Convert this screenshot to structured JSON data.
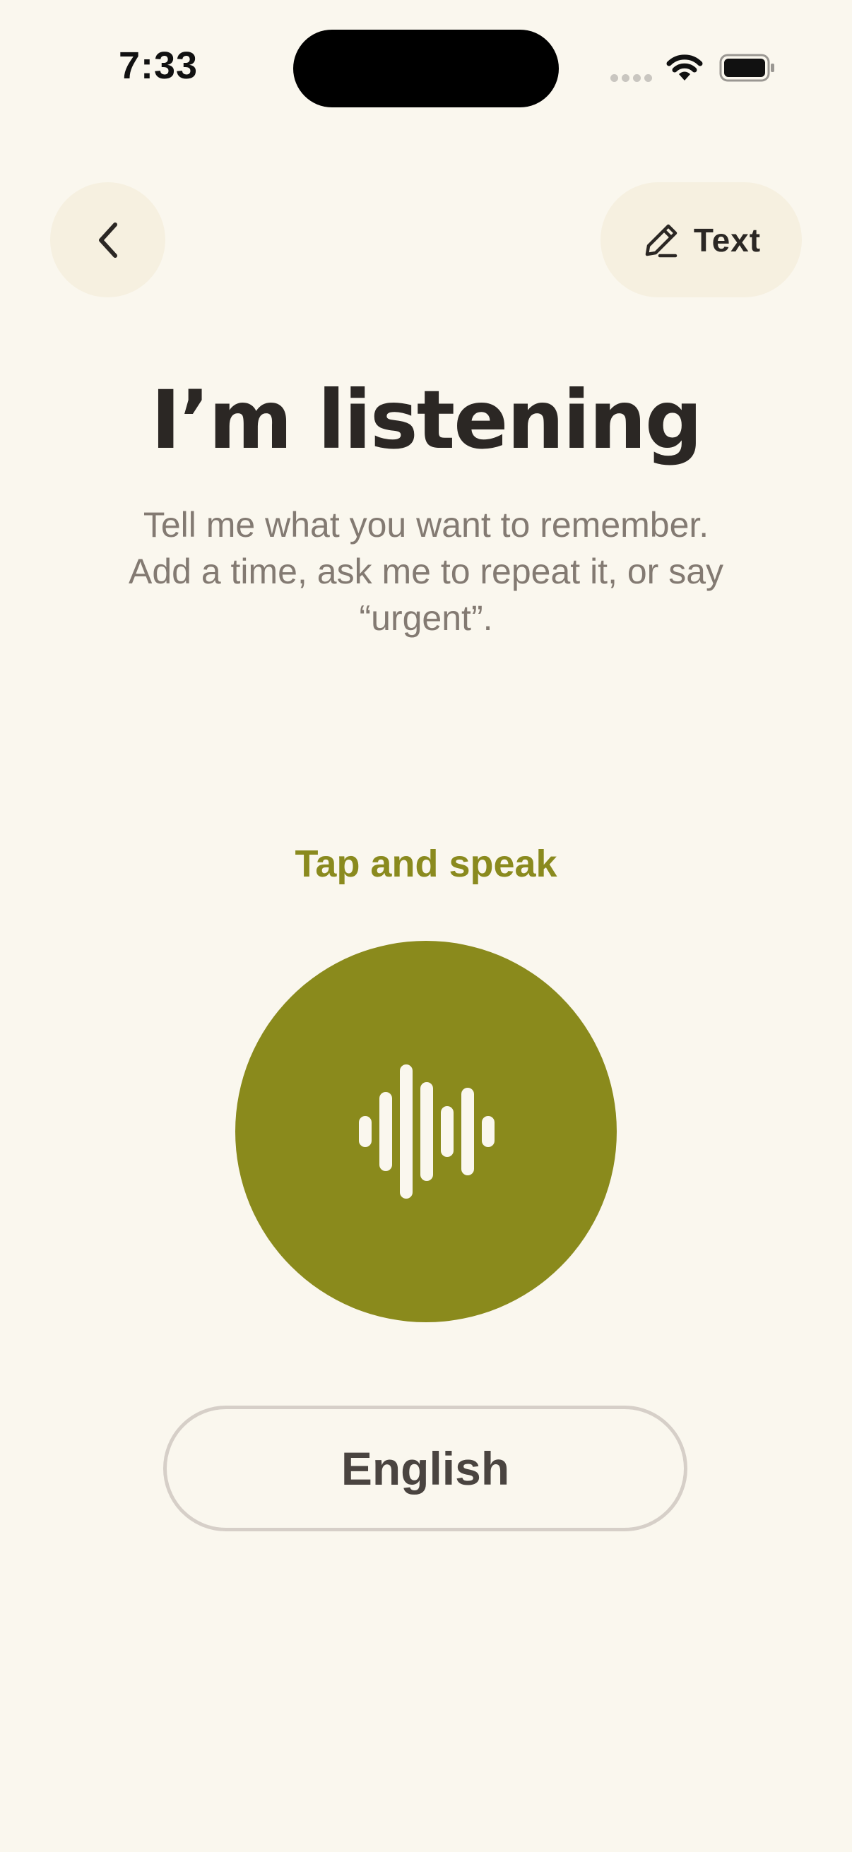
{
  "status_bar": {
    "time": "7:33"
  },
  "header": {
    "back_icon": "chevron-left-icon",
    "text_mode_icon": "pencil-icon",
    "text_mode_label": "Text"
  },
  "main": {
    "title": "I’m listening",
    "subtitle_lines": [
      "Tell me what you want to remember.",
      "Add a time, ask me to repeat it, or say",
      "“urgent”."
    ],
    "tap_label": "Tap and speak",
    "mic_icon": "audio-waveform-icon",
    "language_label": "English"
  },
  "colors": {
    "background": "#faf7ee",
    "accent": "#8a8a1c",
    "button_bg": "#f6f0e0",
    "title": "#2b2724",
    "subtitle": "#837a72"
  }
}
